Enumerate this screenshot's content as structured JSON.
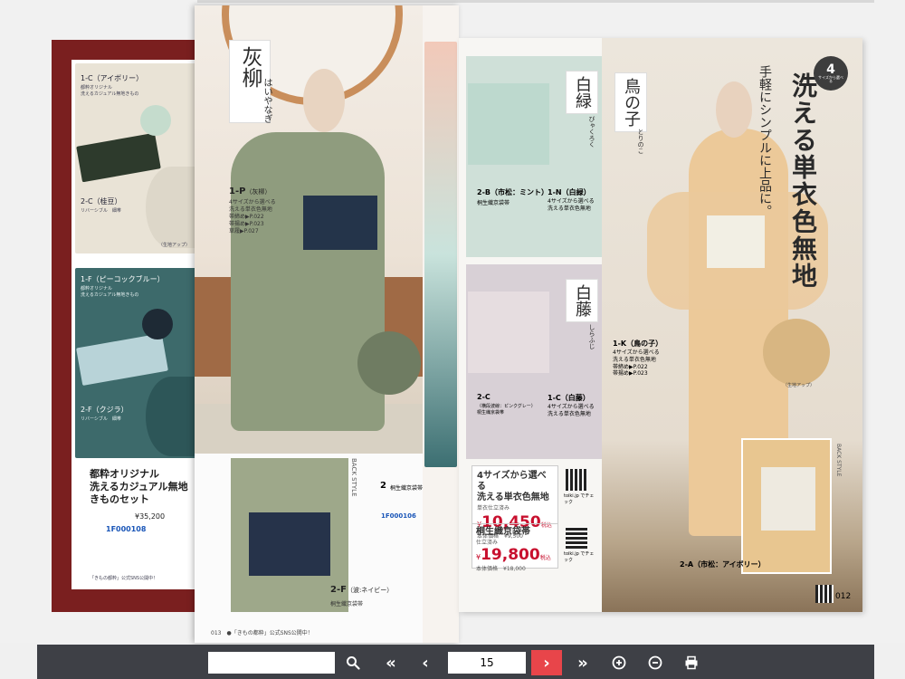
{
  "colors": {
    "accent": "#e8454a",
    "toolbar": "#3e4046",
    "price": "#c8102e",
    "border": "#7a1f1f"
  },
  "left_page": {
    "item1_label": "1-C（アイボリー）",
    "item1_desc1": "都粋オリジナル",
    "item1_desc2": "洗えるカジュアル無地きもの",
    "item2_label": "2-C（桂豆）",
    "item2_desc": "リバーシブル　細帯",
    "item3_label": "1-F（ピーコックブルー）",
    "item3_desc1": "都粋オリジナル",
    "item3_desc2": "洗えるカジュアル無地きもの",
    "item4_label": "2-F（クジラ）",
    "item4_desc": "リバーシブル　細帯",
    "zoom_note": "（生地アップ）",
    "set_title1": "都粋オリジナル",
    "set_title2": "洗えるカジュアル無地",
    "set_title3": "きものセット",
    "set_price": "¥35,200",
    "product_code": "1F000108",
    "footer": "「きもの都粋」公式SNS公開中！"
  },
  "curl_page": {
    "title_big": "灰柳",
    "title_ruby": "はいやなぎ",
    "item_label": "1-P",
    "item_color": "（灰柳）",
    "item_desc1": "4サイズから選べる",
    "item_desc2": "洗える単衣色無地",
    "ref1": "帯締め▶P.022",
    "ref2": "帯揚め▶P.023",
    "ref3": "草履▶P.027",
    "obi_label": "2-F",
    "obi_color": "（波:ネイビー）",
    "obi_desc": "桐生織京袋帯",
    "back_style": "BACK STYLE",
    "side_num": "2",
    "side_title": "桐生織京袋帯",
    "side_code": "1F000106",
    "footer": "013　●「きもの都粋」公式SNS公開中！"
  },
  "right_page": {
    "title1": "白緑",
    "title1_ruby": "びゃくろく",
    "title2": "鳥の子",
    "title2_ruby": "とりのこ",
    "title3": "白藤",
    "title3_ruby": "しらふじ",
    "badge_num": "4",
    "badge_text": "サイズから選べる",
    "headline": "洗える単衣色無地",
    "subhead": "手軽にシンプルに上品に。",
    "item_2b": "2-B（市松：ミント）",
    "item_2b_desc": "桐生織京袋帯",
    "item_1n": "1-N（白緑）",
    "item_1n_desc1": "4サイズから選べる",
    "item_1n_desc2": "洗える単衣色無地",
    "item_2c": "2-C",
    "item_2c_color": "（横段波線：ピンクグレー）",
    "item_2c_desc": "桐生織京袋帯",
    "item_1c": "1-C（白藤）",
    "item_1c_desc1": "4サイズから選べる",
    "item_1c_desc2": "洗える単衣色無地",
    "item_1k": "1-K（鳥の子）",
    "item_1k_desc1": "4サイズから選べる",
    "item_1k_desc2": "洗える単衣色無地",
    "item_1k_ref1": "帯締め▶P.022",
    "item_1k_ref2": "帯揚め▶P.023",
    "item_2a": "2-A（市松：アイボリー）",
    "zoom_note": "（生地アップ）",
    "back_style": "BACK STYLE",
    "box1_title1": "4サイズから選べる",
    "box1_title2": "洗える単衣色無地",
    "box1_sub": "単衣仕立済み",
    "box1_price": "10,450",
    "box1_tax": "税込",
    "box1_base": "本体価格　¥9,500",
    "box2_title": "桐生織京袋帯",
    "box2_sub": "仕立済み",
    "box2_price": "19,800",
    "box2_tax": "税込",
    "box2_base": "本体価格　¥18,000",
    "qr_caption": "toiki.jp でチェック",
    "page_num": "012"
  },
  "toolbar": {
    "search_value": "",
    "search_placeholder": "",
    "page_value": "15",
    "icons": [
      "search-icon",
      "first-page-icon",
      "prev-page-icon",
      "next-page-icon",
      "last-page-icon",
      "zoom-in-icon",
      "zoom-out-icon",
      "print-icon"
    ]
  }
}
